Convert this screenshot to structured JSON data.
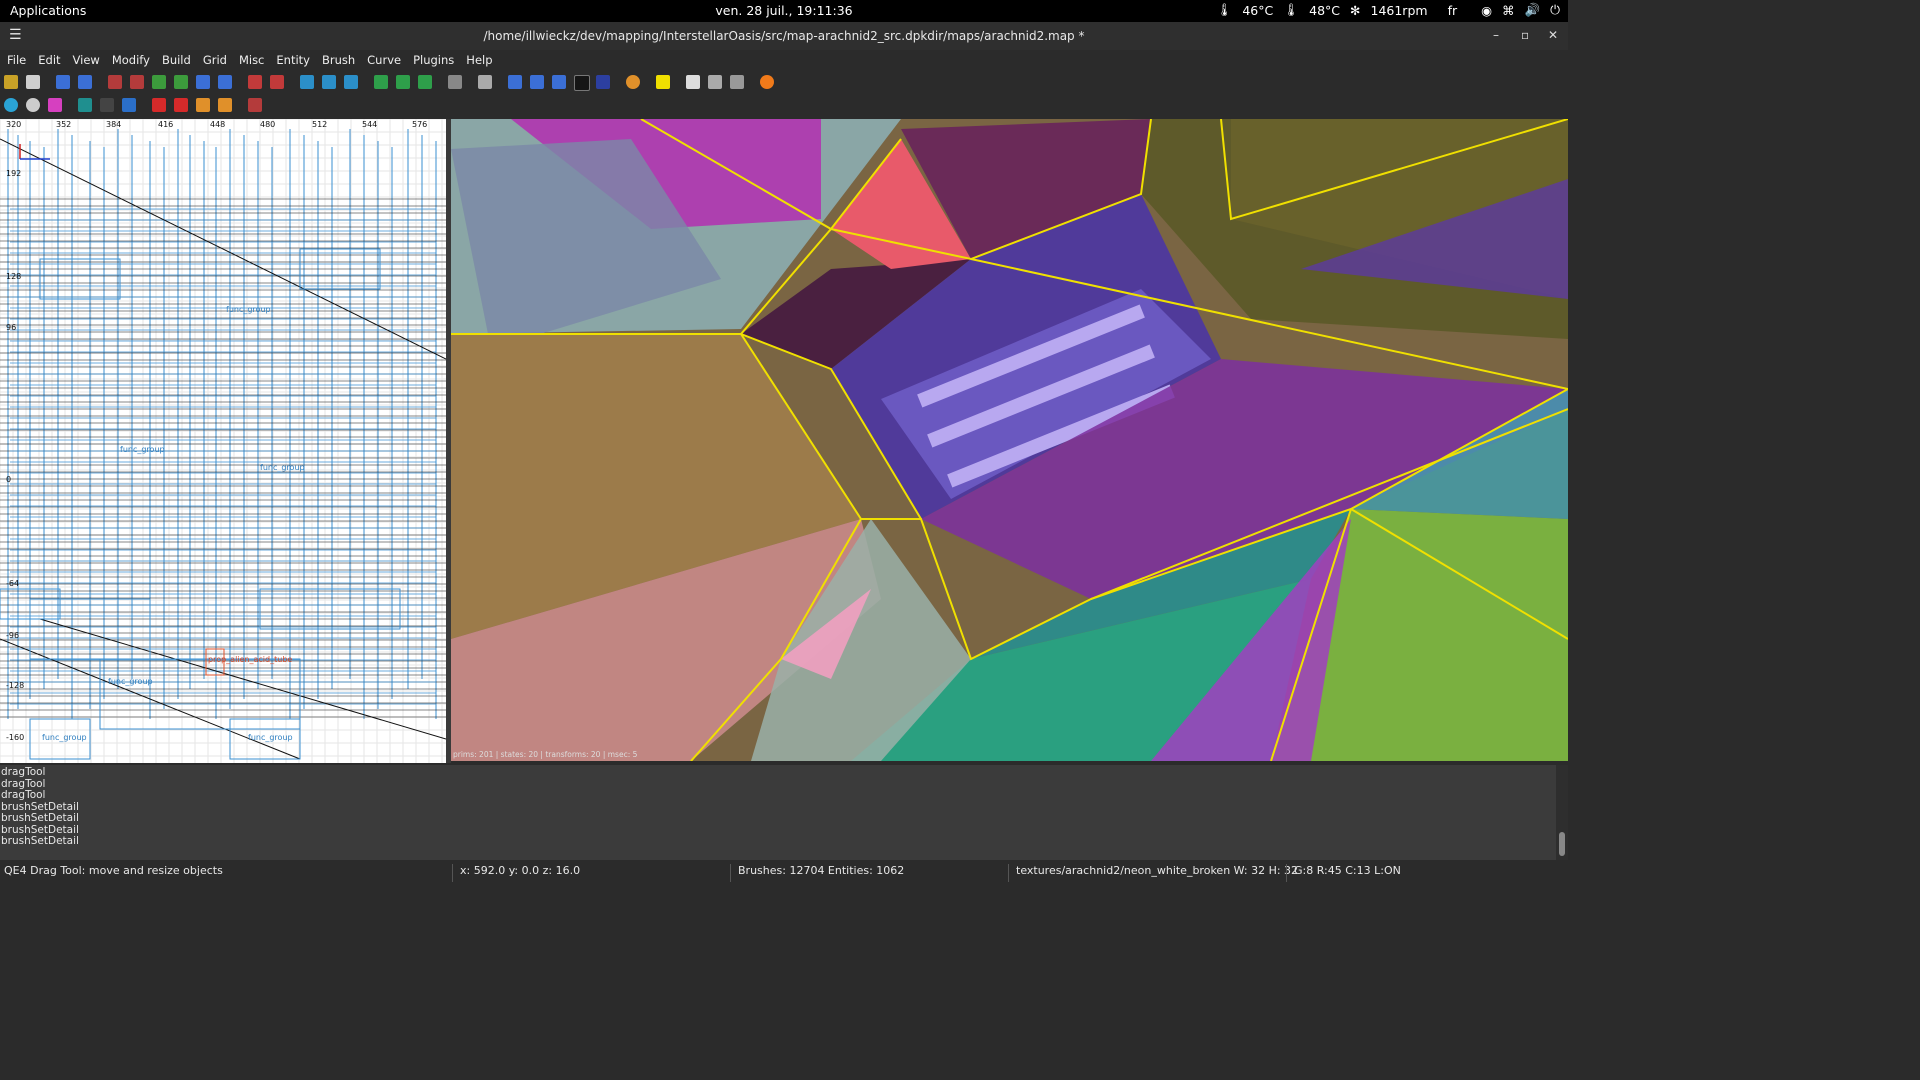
{
  "topbar": {
    "applications": "Applications",
    "clock": "ven. 28 juil., 19:11:36",
    "cpu_temp": "46°C",
    "gpu_temp": "48°C",
    "fan": "1461rpm",
    "lang": "fr"
  },
  "window": {
    "title": "/home/illwieckz/dev/mapping/InterstellarOasis/src/map-arachnid2_src.dpkdir/maps/arachnid2.map *",
    "minimize": "–",
    "maximize": "▫",
    "close": "✕"
  },
  "menu": [
    "File",
    "Edit",
    "View",
    "Modify",
    "Build",
    "Grid",
    "Misc",
    "Entity",
    "Brush",
    "Curve",
    "Plugins",
    "Help"
  ],
  "colors": {
    "accent_yellow": "#f0e000",
    "grid_blue": "#3a8fd0",
    "panel_bg": "#2b2b2b"
  },
  "xyview": {
    "ruler_top": [
      "320",
      "352",
      "384",
      "416",
      "448",
      "480",
      "512",
      "544",
      "576"
    ],
    "ruler_left": [
      "192",
      "128",
      "96",
      "0",
      "-64",
      "-96",
      "-128",
      "-160"
    ],
    "labels": [
      "func_group",
      "func_group",
      "func_group",
      "func_group",
      "func_group",
      "func_group",
      "prop_alien_acid_tube"
    ]
  },
  "camera": {
    "stats": "prims: 201 | states: 20 | transforms: 20 | msec: 5"
  },
  "console": [
    "dragTool",
    "dragTool",
    "dragTool",
    "brushSetDetail",
    "brushSetDetail",
    "brushSetDetail",
    "brushSetDetail"
  ],
  "status": {
    "tool": "QE4 Drag Tool: move and resize objects",
    "coords": "x:  592.0  y:    0.0  z:   16.0",
    "counts": "Brushes: 12704 Entities: 1062",
    "texture": "textures/arachnid2/neon_white_broken W: 32 H: 32",
    "grid": "G:8  R:45  C:13  L:ON"
  }
}
